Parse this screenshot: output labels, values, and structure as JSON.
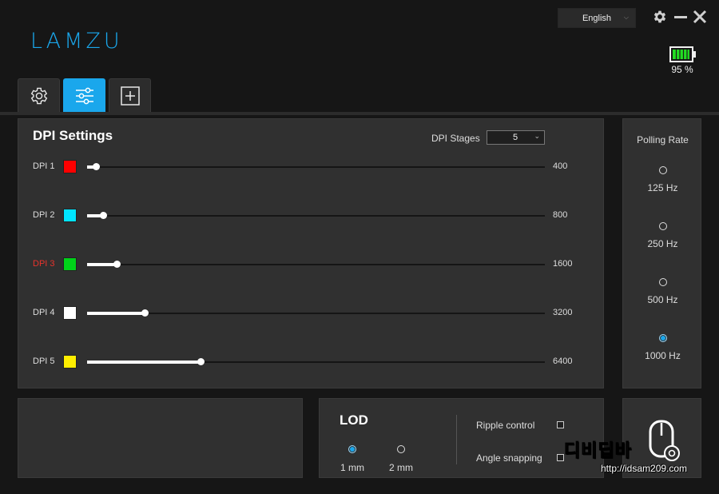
{
  "app": {
    "logo": "LAMZU"
  },
  "header": {
    "language": "English",
    "battery_text": "95 %",
    "battery_level": 0.95
  },
  "tabs": [
    {
      "name": "settings",
      "icon": "gear-icon",
      "active": false
    },
    {
      "name": "sliders",
      "icon": "sliders-icon",
      "active": true
    },
    {
      "name": "macro",
      "icon": "plus-box-icon",
      "active": false
    }
  ],
  "dpi": {
    "title": "DPI Settings",
    "stages_label": "DPI Stages",
    "stages_value": "5",
    "max_dpi": 26000,
    "current_stage": 3,
    "stages": [
      {
        "label": "DPI 1",
        "color": "#ff0000",
        "value": "400",
        "fraction": 0.02
      },
      {
        "label": "DPI 2",
        "color": "#00e5ff",
        "value": "800",
        "fraction": 0.035
      },
      {
        "label": "DPI 3",
        "color": "#00d219",
        "value": "1600",
        "fraction": 0.065
      },
      {
        "label": "DPI 4",
        "color": "#ffffff",
        "value": "3200",
        "fraction": 0.125
      },
      {
        "label": "DPI 5",
        "color": "#ffee00",
        "value": "6400",
        "fraction": 0.247
      }
    ]
  },
  "polling": {
    "title": "Polling Rate",
    "options": [
      {
        "label": "125 Hz",
        "selected": false
      },
      {
        "label": "250 Hz",
        "selected": false
      },
      {
        "label": "500 Hz",
        "selected": false
      },
      {
        "label": "1000 Hz",
        "selected": true
      }
    ]
  },
  "lod": {
    "title": "LOD",
    "options": [
      {
        "label": "1 mm",
        "selected": true
      },
      {
        "label": "2 mm",
        "selected": false
      }
    ],
    "ripple_label": "Ripple control",
    "ripple_checked": false,
    "angle_label": "Angle snapping",
    "angle_checked": false
  },
  "watermark": {
    "text": "디비딥바",
    "url": "http://idsam209.com"
  },
  "colors": {
    "accent": "#1aa7ec",
    "current_dpi_label": "#e8332c",
    "battery": "#22dd22"
  }
}
